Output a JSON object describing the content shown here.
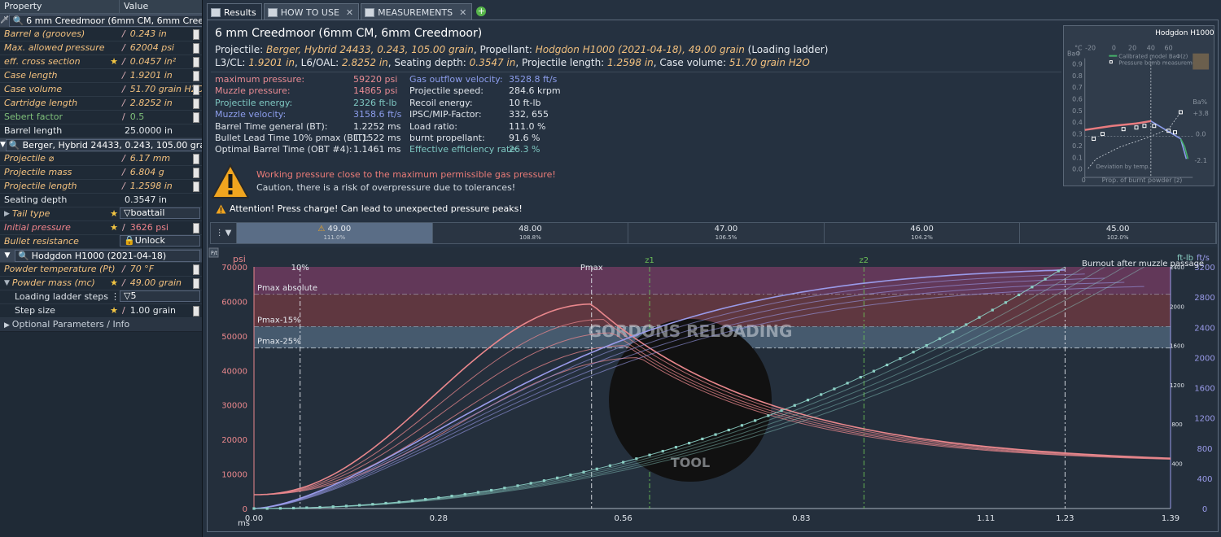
{
  "left": {
    "header": {
      "property": "Property",
      "value": "Value"
    },
    "cartridge": "6 mm Creedmoor (6mm CM, 6mm Creedmoor)",
    "cartridge_rows": [
      {
        "k": "Barrel ⌀ (grooves)",
        "v": "0.243 in",
        "kstyle": "i",
        "vstyle": "i",
        "star": false
      },
      {
        "k": "Max. allowed pressure",
        "v": "62004 psi",
        "kstyle": "i",
        "vstyle": "i",
        "star": false
      },
      {
        "k": "eff. cross section",
        "v": "0.0457 in²",
        "kstyle": "i",
        "vstyle": "i",
        "star": true
      },
      {
        "k": "Case length",
        "v": "1.9201 in",
        "kstyle": "i",
        "vstyle": "i",
        "star": false
      },
      {
        "k": "Case volume",
        "v": "51.70 grain H2O",
        "kstyle": "i",
        "vstyle": "i",
        "star": false
      },
      {
        "k": "Cartridge length",
        "v": "2.8252 in",
        "kstyle": "i",
        "vstyle": "i",
        "star": false
      },
      {
        "k": "Sebert factor",
        "v": "0.5",
        "kstyle": "green",
        "vstyle": "green",
        "star": false
      },
      {
        "k": "Barrel length",
        "v": "25.0000 in",
        "kstyle": "white",
        "vstyle": "white",
        "star": false
      }
    ],
    "projectile": "Berger, Hybrid 24433, 0.243, 105.00 grain",
    "projectile_rows": [
      {
        "k": "Projectile ⌀",
        "v": "6.17 mm",
        "kstyle": "i",
        "vstyle": "i",
        "star": false
      },
      {
        "k": "Projectile mass",
        "v": "6.804 g",
        "kstyle": "i",
        "vstyle": "i",
        "star": false
      },
      {
        "k": "Projectile length",
        "v": "1.2598 in",
        "kstyle": "i",
        "vstyle": "i",
        "star": false
      },
      {
        "k": "Seating depth",
        "v": "0.3547 in",
        "kstyle": "white",
        "vstyle": "white",
        "star": false
      }
    ],
    "tail_type": {
      "k": "Tail type",
      "v": "boattail"
    },
    "initial_pressure": {
      "k": "Initial pressure",
      "v": "3626 psi"
    },
    "bullet_resistance": {
      "k": "Bullet resistance",
      "v": "Unlock"
    },
    "powder": "Hodgdon H1000 (2021-04-18)",
    "powder_temp": {
      "k": "Powder temperature (Pt)",
      "v": "70 °F"
    },
    "powder_mass": {
      "k": "Powder mass (mc)",
      "v": "49.00 grain"
    },
    "ladder_steps": {
      "k": "Loading ladder steps",
      "v": "5"
    },
    "step_size": {
      "k": "Step size",
      "v": "1.00 grain"
    },
    "optional": "Optional Parameters / Info"
  },
  "tabs": [
    {
      "label": "Results",
      "active": true
    },
    {
      "label": "HOW TO USE",
      "active": false
    },
    {
      "label": "MEASUREMENTS",
      "active": false
    }
  ],
  "main": {
    "title": "6 mm Creedmoor (6mm CM, 6mm Creedmoor)",
    "line1": {
      "p1": "Projectile: ",
      "p2": "Berger, Hybrid 24433, 0.243, 105.00 grain",
      "p3": ", Propellant: ",
      "p4": "Hodgdon H1000 (2021-04-18), 49.00 grain",
      "p5": " (Loading ladder)"
    },
    "line2": {
      "a": "L3/CL: ",
      "b": "1.9201 in",
      "c": ", L6/OAL: ",
      "d": "2.8252 in",
      "e": ", Seating depth: ",
      "f": "0.3547 in",
      "g": ", Projectile length: ",
      "h": "1.2598 in",
      "i": ", Case volume: ",
      "j": "51.70 grain H2O"
    },
    "results_left": [
      {
        "label": "maximum pressure:",
        "value": "59220 psi",
        "lc": "pink",
        "vc": "pink"
      },
      {
        "label": "Muzzle pressure:",
        "value": "14865 psi",
        "lc": "pink",
        "vc": "pink"
      },
      {
        "label": "Projectile energy:",
        "value": "2326 ft-lb",
        "lc": "teal",
        "vc": "teal"
      },
      {
        "label": "Muzzle velocity:",
        "value": "3158.6 ft/s",
        "lc": "blue",
        "vc": "blue"
      },
      {
        "label": "Barrel Time general (BT):",
        "value": "1.2252 ms",
        "lc": "wht",
        "vc": "wht"
      },
      {
        "label": "Bullet Lead Time 10% pmax (BLT):",
        "value": "1.1522 ms",
        "lc": "wht",
        "vc": "wht"
      },
      {
        "label": "Optimal Barrel Time (OBT #4):",
        "value": "1.1461 ms",
        "lc": "wht",
        "vc": "wht"
      }
    ],
    "results_right": [
      {
        "label": "Gas outflow velocity:",
        "value": "3528.8 ft/s",
        "lc": "blue",
        "vc": "blue"
      },
      {
        "label": "Projectile speed:",
        "value": "284.6 krpm",
        "lc": "wht",
        "vc": "wht"
      },
      {
        "label": "Recoil energy:",
        "value": "10 ft-lb",
        "lc": "wht",
        "vc": "wht"
      },
      {
        "label": "IPSC/MIP-Factor:",
        "value": "332, 655",
        "lc": "wht",
        "vc": "wht"
      },
      {
        "label": "Load ratio:",
        "value": "111.0 %",
        "lc": "wht",
        "vc": "wht"
      },
      {
        "label": "burnt propellant:",
        "value": "91.6 %",
        "lc": "wht",
        "vc": "wht"
      },
      {
        "label": "Effective efficiency rate:",
        "value": "26.3 %",
        "lc": "teal",
        "vc": "teal"
      }
    ],
    "warn1": "Working pressure close to the maximum permissible gas pressure!",
    "warn2": "Caution, there is a risk of overpressure due to tolerances!",
    "warn3": "Attention! Press charge! Can lead to unexpected pressure peaks!"
  },
  "mini": {
    "title": "Hodgdon H1000",
    "top_axis": [
      "°C",
      "-20",
      "0",
      "20",
      "40",
      "60"
    ],
    "left_axis": [
      "0.9",
      "0.8",
      "0.7",
      "0.6",
      "0.5",
      "0.4",
      "0.3",
      "0.2",
      "0.1",
      "0.0"
    ],
    "right_axis": [
      "+3.8",
      "0.0",
      "-2.1"
    ],
    "left_unit": "BaΦ",
    "right_unit": "Ba%",
    "legend": [
      "Calibrated model BaΦ(z)",
      "Pressure bomb measurement"
    ],
    "deviation": "Deviation by temp.",
    "xlabel": "Prop. of burnt powder (z)",
    "x0": "0"
  },
  "ladder": {
    "steps": [
      {
        "charge": "49.00",
        "pct": "111.0%",
        "selected": true,
        "warn": true
      },
      {
        "charge": "48.00",
        "pct": "108.8%",
        "selected": false,
        "warn": false
      },
      {
        "charge": "47.00",
        "pct": "106.5%",
        "selected": false,
        "warn": false
      },
      {
        "charge": "46.00",
        "pct": "104.2%",
        "selected": false,
        "warn": false
      },
      {
        "charge": "45.00",
        "pct": "102.0%",
        "selected": false,
        "warn": false
      }
    ]
  },
  "chart_data": {
    "type": "line",
    "xlabel": "ms",
    "ylabel": "psi",
    "y2label": "ft/s",
    "y3label": "ft-lb",
    "xlim": [
      0,
      1.39
    ],
    "ylim": [
      0,
      70000
    ],
    "y2lim": [
      0,
      3200
    ],
    "x_ticks": [
      "0.00",
      "0.28",
      "0.56",
      "0.83",
      "1.11",
      "1.23",
      "1.39"
    ],
    "x_tick_values": [
      0,
      0.28,
      0.56,
      0.83,
      1.11,
      1.23,
      1.39
    ],
    "y_ticks": [
      0,
      10000,
      20000,
      30000,
      40000,
      50000,
      60000,
      70000
    ],
    "y2_ticks": [
      0,
      400,
      800,
      1200,
      1600,
      2000,
      2400,
      2800,
      3200
    ],
    "y3_ticks": [
      {
        "v": 400,
        "at": 600
      },
      {
        "v": 800,
        "at": 1120
      },
      {
        "v": 1200,
        "at": 1640
      },
      {
        "v": 1600,
        "at": 2160
      },
      {
        "v": 2000,
        "at": 2680
      },
      {
        "v": 2400,
        "at": 3200
      }
    ],
    "bands": [
      {
        "label": "Pmax absolute",
        "from": 62004,
        "to": 70000,
        "color": "#6d3a5e"
      },
      {
        "label": "Pmax-15%",
        "from": 52703,
        "to": 62004,
        "color": "#6a3841"
      },
      {
        "label": "Pmax-25%",
        "from": 46503,
        "to": 52703,
        "color": "#4c6177"
      }
    ],
    "markers": [
      {
        "label": "10%",
        "x": 0.07
      },
      {
        "label": "Pmax",
        "x": 0.512
      },
      {
        "label": "z1",
        "x": 0.6
      },
      {
        "label": "z2",
        "x": 0.925
      },
      {
        "label": "",
        "x": 1.23
      }
    ],
    "burnout_label": "Burnout after muzzle passage",
    "watermark_top": "GORDONS RELOADING",
    "watermark_bottom": "TOOL",
    "pressure_series": [
      {
        "charge": "49.00",
        "peak": 59220,
        "tpeak": 0.512,
        "muzzle": 14865
      },
      {
        "charge": "48.00",
        "peak": 54800,
        "tpeak": 0.53,
        "muzzle": 15000
      },
      {
        "charge": "47.00",
        "peak": 50900,
        "tpeak": 0.545,
        "muzzle": 15100
      },
      {
        "charge": "46.00",
        "peak": 47200,
        "tpeak": 0.565,
        "muzzle": 15200
      },
      {
        "charge": "45.00",
        "peak": 43700,
        "tpeak": 0.585,
        "muzzle": 15300
      }
    ],
    "velocity_series": [
      {
        "charge": "49.00",
        "muzzle_velocity": 3158.6,
        "exit_time": 1.23
      },
      {
        "charge": "48.00",
        "muzzle_velocity": 3105,
        "exit_time": 1.26
      },
      {
        "charge": "47.00",
        "muzzle_velocity": 3050,
        "exit_time": 1.29
      },
      {
        "charge": "46.00",
        "muzzle_velocity": 2995,
        "exit_time": 1.32
      },
      {
        "charge": "45.00",
        "muzzle_velocity": 2940,
        "exit_time": 1.35
      }
    ],
    "energy_muzzle": 2326
  },
  "colors": {
    "pressure": "#e9878c",
    "velocity": "#9a9bea",
    "energy": "#8cd0c5",
    "marker_green": "#6bbf57"
  }
}
